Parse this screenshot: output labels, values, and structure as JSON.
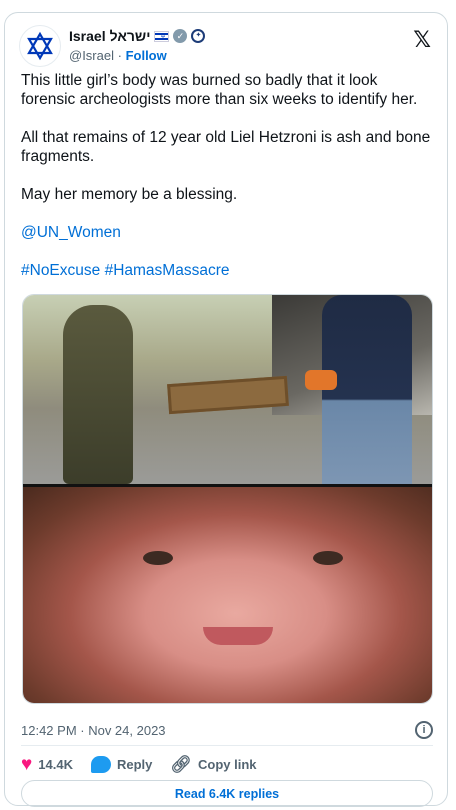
{
  "account": {
    "name": "Israel",
    "name_hebrew": "ישראל",
    "handle": "@Israel",
    "follow_label": "Follow"
  },
  "tweet": {
    "paragraphs": [
      "This little girl’s body was burned so badly that it look forensic archeologists more than six weeks to identify her.",
      "All that remains of 12 year old Liel Hetzroni is ash and bone fragments.",
      "May her memory be a blessing."
    ],
    "mention": "@UN_Women",
    "hashtags": "#NoExcuse #HamasMassacre",
    "timestamp": "12:42 PM · Nov 24, 2023"
  },
  "actions": {
    "likes": "14.4K",
    "reply_label": "Reply",
    "copy_link_label": "Copy link",
    "read_replies_label": "Read 6.4K replies"
  },
  "icons": {
    "avatar": "star-of-david-icon",
    "verified": "verified-badge-icon",
    "seal": "government-seal-icon",
    "platform": "x-logo-icon",
    "info": "info-icon",
    "like": "heart-icon",
    "reply": "reply-bubble-icon",
    "copy": "link-icon"
  },
  "colors": {
    "link": "#006fd6",
    "like": "#f91880",
    "reply": "#1d9bf0",
    "muted": "#536471",
    "border": "#cfd9de"
  }
}
